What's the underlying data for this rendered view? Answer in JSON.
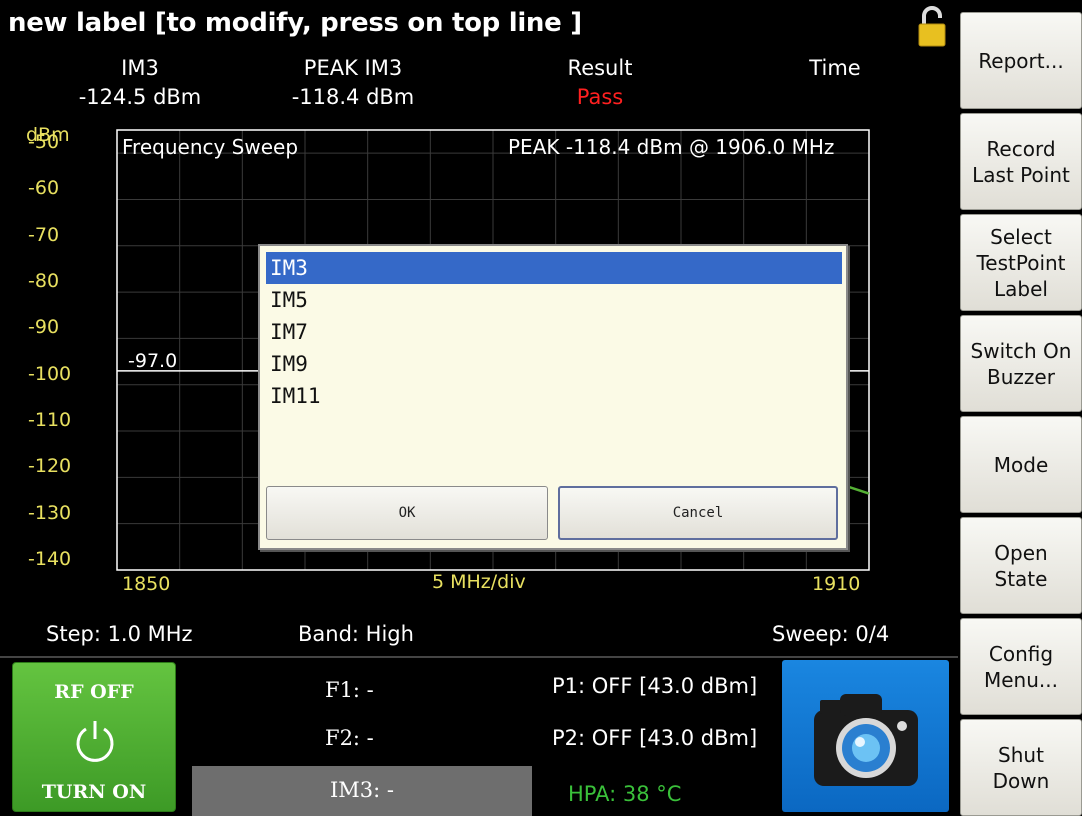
{
  "title": "new label [to modify, press on top line ]",
  "readouts": {
    "im3": {
      "label": "IM3",
      "value": "-124.5 dBm"
    },
    "peak_im3": {
      "label": "PEAK IM3",
      "value": "-118.4 dBm"
    },
    "result": {
      "label": "Result",
      "value": "Pass"
    },
    "time": {
      "label": "Time",
      "value": ""
    }
  },
  "chart": {
    "y_unit": "dBm",
    "title": "Frequency Sweep",
    "peak_text": "PEAK -118.4 dBm @ 1906.0 MHz",
    "y_ticks": [
      "-50",
      "-60",
      "-70",
      "-80",
      "-90",
      "-100",
      "-110",
      "-120",
      "-130",
      "-140"
    ],
    "x_tick_left": "1850",
    "x_tick_mid": "5 MHz/div",
    "x_tick_right": "1910",
    "limit_label": "-97.0"
  },
  "chart_data": {
    "type": "line",
    "title": "Frequency Sweep",
    "xlabel": "",
    "ylabel": "dBm",
    "xlim": [
      1850,
      1910
    ],
    "ylim": [
      -140,
      -45
    ],
    "x_scale": "5 MHz/div",
    "grid": true,
    "series": [
      {
        "name": "limit",
        "x": [
          1850,
          1910
        ],
        "y": [
          -97.0,
          -97.0
        ]
      },
      {
        "name": "",
        "x": [
          1905.5,
          1910
        ],
        "y": [
          -119.5,
          -123.5
        ]
      }
    ]
  },
  "status": {
    "step": "Step: 1.0 MHz",
    "band": "Band: High",
    "sweep": "Sweep: 0/4"
  },
  "bottom": {
    "rf_state": "RF OFF",
    "rf_action": "TURN ON",
    "f1": "F1: -",
    "f2": "F2: -",
    "im3": "IM3: -",
    "p1": "P1: OFF [43.0 dBm]",
    "p2": "P2: OFF [43.0 dBm]",
    "hpa": "HPA: 38 °C"
  },
  "sidebar": [
    "Report...",
    "Record\nLast Point",
    "Select\nTestPoint\nLabel",
    "Switch On\nBuzzer",
    "Mode",
    "Open\nState",
    "Config\nMenu...",
    "Shut\nDown"
  ],
  "dialog": {
    "items": [
      "IM3",
      "IM5",
      "IM7",
      "IM9",
      "IM11"
    ],
    "selected": "IM3",
    "ok_label": "OK",
    "cancel_label": "Cancel"
  },
  "colors": {
    "tick_yellow": "#e8e060",
    "pass_red": "#ff2020",
    "hpa_green": "#3ac03a",
    "rf_green": "#4fae30",
    "camera_blue": "#1076d2",
    "selection_blue": "#3569c8",
    "dialog_bg": "#fbfae6"
  },
  "icons": [
    "lock-icon",
    "power-icon",
    "camera-icon"
  ]
}
